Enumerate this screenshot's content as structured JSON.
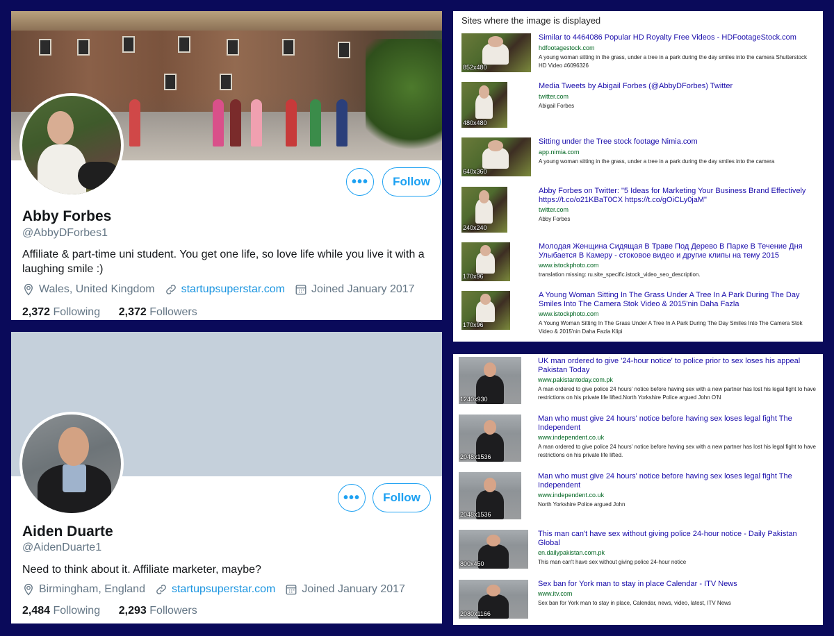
{
  "profiles": [
    {
      "name": "Abby Forbes",
      "handle": "@AbbyDForbes1",
      "bio": "Affiliate & part-time uni student. You get one life, so love life while you live it with a laughing smile :)",
      "location": "Wales, United Kingdom",
      "website": "startupsuperstar.com",
      "joined": "Joined January 2017",
      "following_count": "2,372",
      "following_label": "Following",
      "followers_count": "2,372",
      "followers_label": "Followers",
      "more_label": "•••",
      "follow_label": "Follow"
    },
    {
      "name": "Aiden Duarte",
      "handle": "@AidenDuarte1",
      "bio": "Need to think about it. Affiliate marketer, maybe?",
      "location": "Birmingham, England",
      "website": "startupsuperstar.com",
      "joined": "Joined January 2017",
      "following_count": "2,484",
      "following_label": "Following",
      "followers_count": "2,293",
      "followers_label": "Followers",
      "more_label": "•••",
      "follow_label": "Follow"
    }
  ],
  "panel1": {
    "title": "Sites where the image is displayed",
    "results": [
      {
        "dim": "852x480",
        "title": "Similar to 4464086 Popular HD Royalty Free Videos - HDFootageStock.com",
        "url": "hdfootagestock.com",
        "desc": "A young woman sitting in the grass, under a tree in a park during the day smiles into the camera Shutterstock HD Video #6096326"
      },
      {
        "dim": "480x480",
        "title": "Media Tweets by Abigail Forbes (@AbbyDForbes) Twitter",
        "url": "twitter.com",
        "desc": "Abigail Forbes"
      },
      {
        "dim": "640x360",
        "title": "Sitting under the Tree stock footage Nimia.com",
        "url": "app.nimia.com",
        "desc": "A young woman sitting in the grass, under a tree in a park during the day smiles into the camera"
      },
      {
        "dim": "240x240",
        "title": "Abby Forbes on Twitter: \"5 Ideas for Marketing Your Business Brand Effectively https://t.co/o21KBaT0CX https://t.co/gOiCLy0jaM\"",
        "url": "twitter.com",
        "desc": "Abby Forbes"
      },
      {
        "dim": "170x96",
        "title": "Молодая Женщина Сидящая В Траве Под Дерево В Парке В Течение Дня Улыбается В Камеру - стоковое видео и другие клипы на тему 2015",
        "url": "www.istockphoto.com",
        "desc": "translation missing: ru.site_specific.istock_video_seo_description."
      },
      {
        "dim": "170x96",
        "title": "A Young Woman Sitting In The Grass Under A Tree In A Park During The Day Smiles Into The Camera Stok Video & 2015'nin Daha Fazla",
        "url": "www.istockphoto.com",
        "desc": "A Young Woman Sitting In The Grass Under A Tree In A Park During The Day Smiles Into The Camera Stok Video & 2015'nin Daha Fazla Klipi"
      }
    ]
  },
  "panel2": {
    "results": [
      {
        "dim": "1240x930",
        "title": "UK man ordered to give '24-hour notice' to police prior to sex loses his appeal Pakistan Today",
        "url": "www.pakistantoday.com.pk",
        "desc": "A man ordered to give police 24 hours' notice before having sex with a new partner has lost his legal fight to have restrictions on his private life lifted.North Yorkshire Police argued John O'N"
      },
      {
        "dim": "2048x1536",
        "title": "Man who must give 24 hours' notice before having sex loses legal fight The Independent",
        "url": "www.independent.co.uk",
        "desc": "A man ordered to give police 24 hours' notice before having sex with a new partner has lost his legal fight to have restrictions on his private life lifted."
      },
      {
        "dim": "2048x1536",
        "title": "Man who must give 24 hours' notice before having sex loses legal fight The Independent",
        "url": "www.independent.co.uk",
        "desc": "North Yorkshire Police argued John"
      },
      {
        "dim": "800x450",
        "title": "This man can't have sex without giving police 24-hour notice - Daily Pakistan Global",
        "url": "en.dailypakistan.com.pk",
        "desc": "This man can't have sex without giving police 24-hour notice"
      },
      {
        "dim": "2080x1166",
        "title": "Sex ban for York man to stay in place Calendar - ITV News",
        "url": "www.itv.com",
        "desc": "Sex ban for York man to stay in place, Calendar, news, video, latest, ITV News"
      }
    ]
  }
}
